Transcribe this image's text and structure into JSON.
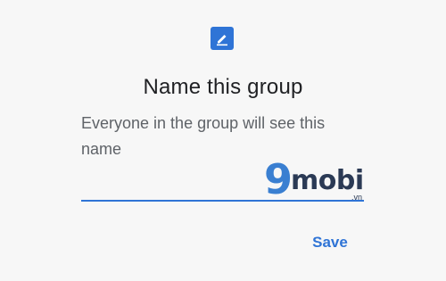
{
  "dialog": {
    "icon": "edit-icon",
    "title": "Name this group",
    "subtitle": "Everyone in the group will see this name",
    "name_field": {
      "value": "",
      "placeholder": ""
    },
    "save_label": "Save"
  },
  "watermark": {
    "nine": "9",
    "mobi": "mobi",
    "vn": ".vn"
  },
  "colors": {
    "accent": "#2f74d6",
    "background": "#f7f7f7",
    "title": "#202124",
    "subtitle": "#5f6368"
  }
}
